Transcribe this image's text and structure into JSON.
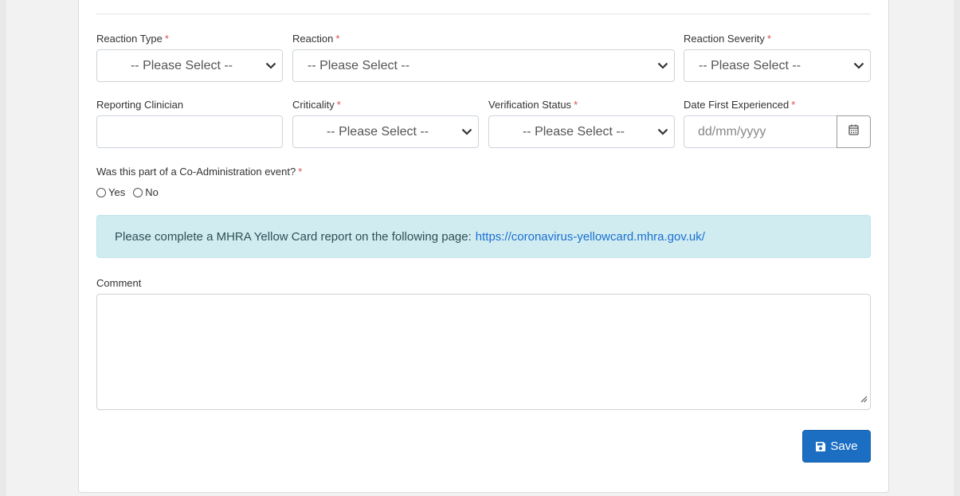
{
  "form": {
    "reaction_type": {
      "label": "Reaction Type",
      "value": "-- Please Select --"
    },
    "reaction": {
      "label": "Reaction",
      "value": "-- Please Select --"
    },
    "reaction_severity": {
      "label": "Reaction Severity",
      "value": "-- Please Select --"
    },
    "reporting_clinician": {
      "label": "Reporting Clinician",
      "value": ""
    },
    "criticality": {
      "label": "Criticality",
      "value": "-- Please Select --"
    },
    "verification_status": {
      "label": "Verification Status",
      "value": "-- Please Select --"
    },
    "date_first_experienced": {
      "label": "Date First Experienced",
      "placeholder": "dd/mm/yyyy"
    },
    "co_administration": {
      "label": "Was this part of a Co-Administration event?",
      "options": [
        "Yes",
        "No"
      ]
    },
    "required_marker": "*",
    "alert": {
      "text": "Please complete a MHRA Yellow Card report on the following page:",
      "link": "https://coronavirus-yellowcard.mhra.gov.uk/"
    },
    "comment": {
      "label": "Comment",
      "value": ""
    },
    "save_label": "Save"
  },
  "colors": {
    "primary": "#1b6ec2",
    "required": "#d9534f",
    "alert_bg": "#d1ecf1",
    "link": "#1a6fd1"
  },
  "icons": [
    "chevron-down-icon",
    "calendar-icon",
    "save-icon",
    "resize-grip-icon"
  ]
}
